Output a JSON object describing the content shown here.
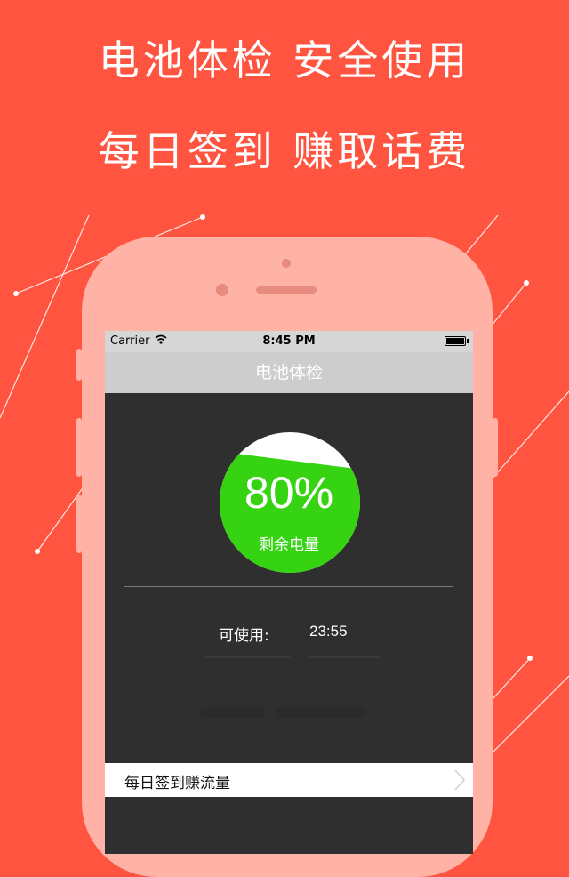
{
  "promo": {
    "line1": "电池体检  安全使用",
    "line2": "每日签到  赚取话费"
  },
  "statusbar": {
    "carrier": "Carrier",
    "time": "8:45 PM"
  },
  "navbar": {
    "title": "电池体检"
  },
  "battery": {
    "percent_text": "80%",
    "level": 0.8,
    "label": "剩余电量"
  },
  "usage": {
    "label": "可使用:",
    "value": "23:55"
  },
  "signin": {
    "label": "每日签到赚流量"
  },
  "colors": {
    "background": "#ff5540",
    "phone_body": "#ffb3a6",
    "gauge_fill": "#35d312",
    "screen": "#2f2f2f",
    "navbar": "#cdcdcd"
  }
}
